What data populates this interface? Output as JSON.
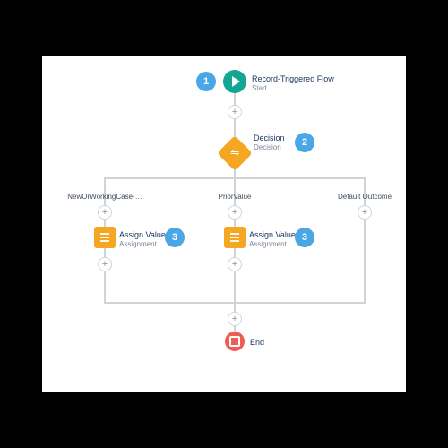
{
  "flow": {
    "start": {
      "title": "Record-Triggered Flow",
      "subtitle": "Start"
    },
    "decision": {
      "title": "Decision",
      "subtitle": "Decision"
    },
    "branches": {
      "left": "NewOrWorkingCase-…",
      "center": "PriorValue",
      "right": "Default Outcome"
    },
    "assignLeft": {
      "title": "Assign Value",
      "subtitle": "Assignment"
    },
    "assignCenter": {
      "title": "Assign Value",
      "subtitle": "Assignment"
    },
    "end": "End"
  },
  "callouts": {
    "one": "1",
    "two": "2",
    "three_a": "3",
    "three_b": "3"
  },
  "icons": {
    "start": "play-circle-icon",
    "decision": "decision-diamond-icon",
    "assign": "assignment-icon",
    "end": "stop-circle-icon",
    "connector": "plus-connector-icon"
  },
  "colors": {
    "callout": "#4aa7e6",
    "startNode": "#13a793",
    "decisionNode": "#f5a623",
    "assignNode": "#f5a623",
    "endNode": "#ef5b55",
    "connector": "#cfd4d9"
  }
}
